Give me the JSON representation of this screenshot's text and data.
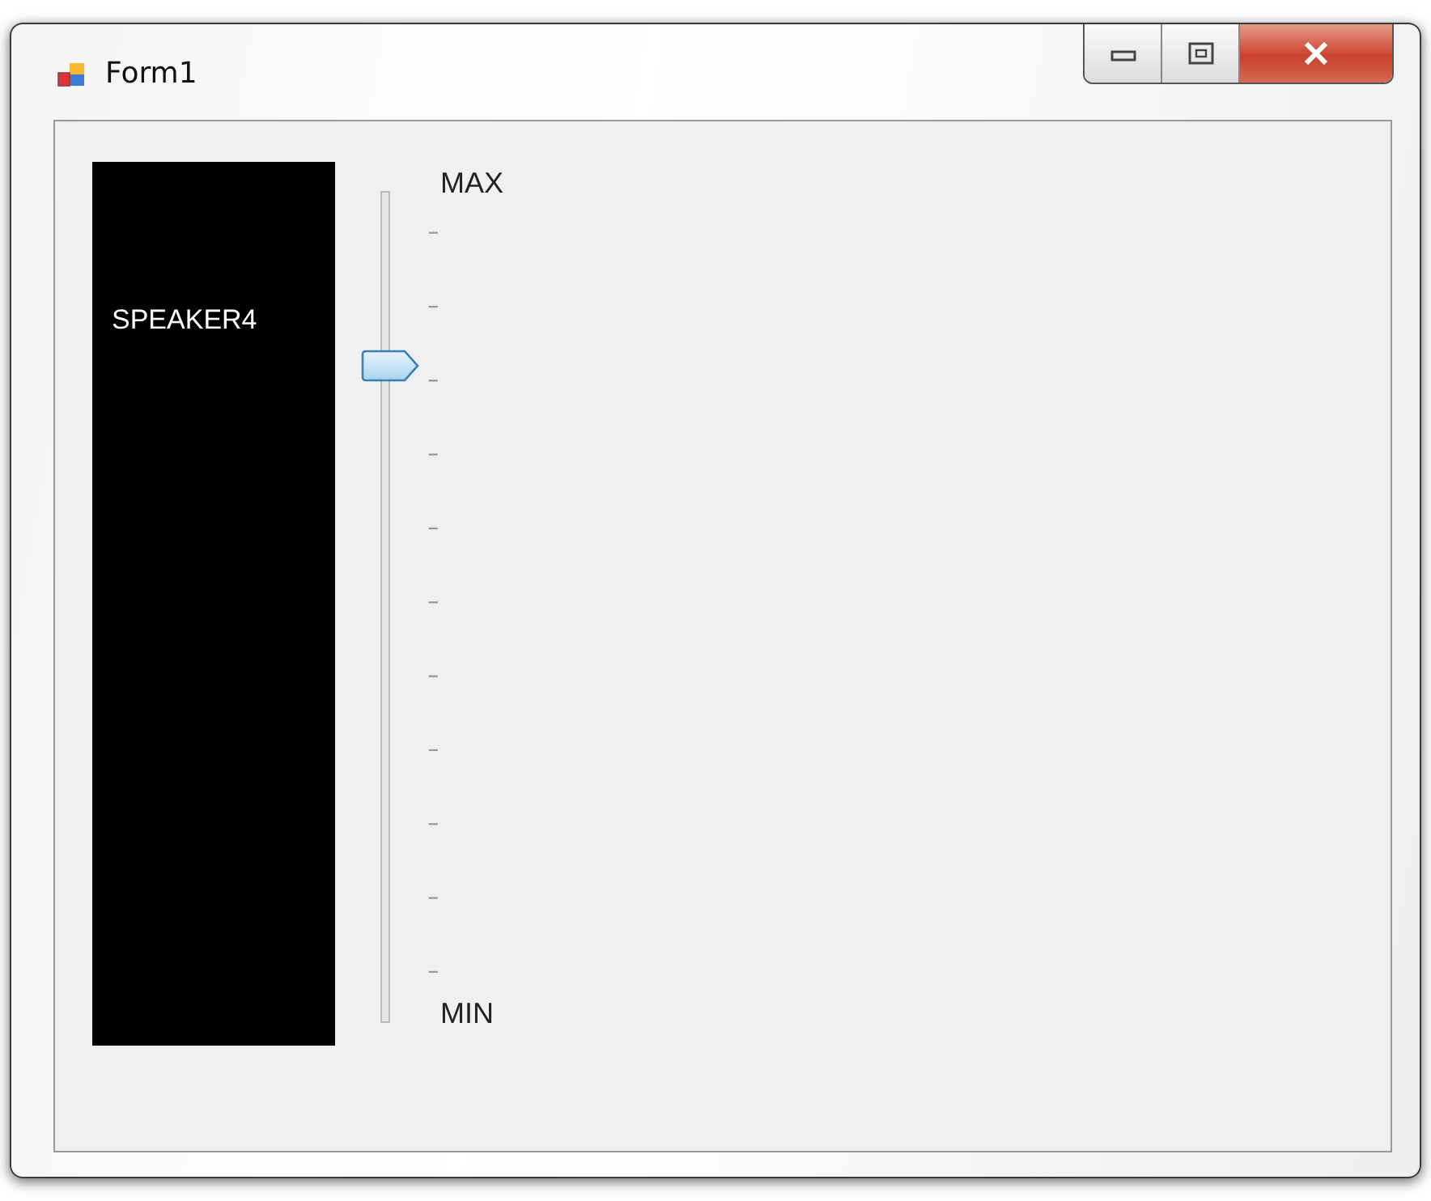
{
  "window": {
    "title": "Form1"
  },
  "speaker_panel": {
    "label": "SPEAKER4"
  },
  "volume_slider": {
    "level": 0.8,
    "max_label": "MAX",
    "min_label": "MIN"
  }
}
